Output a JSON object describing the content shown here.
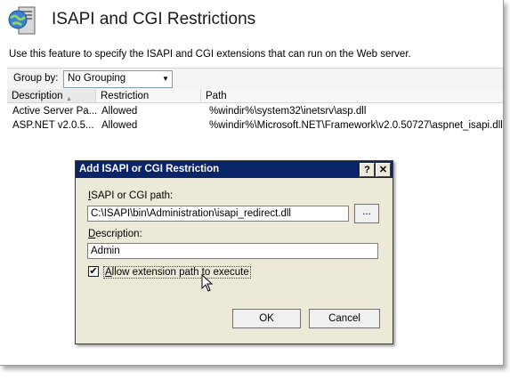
{
  "header": {
    "title": "ISAPI and CGI Restrictions",
    "description": "Use this feature to specify the ISAPI and CGI extensions that can run on the Web server."
  },
  "group_bar": {
    "label": "Group by:",
    "selected": "No Grouping"
  },
  "grid": {
    "columns": [
      "Description",
      "Restriction",
      "Path"
    ],
    "rows": [
      {
        "description": "Active Server Pa...",
        "restriction": "Allowed",
        "path": "%windir%\\system32\\inetsrv\\asp.dll"
      },
      {
        "description": "ASP.NET v2.0.5...",
        "restriction": "Allowed",
        "path": "%windir%\\Microsoft.NET\\Framework\\v2.0.50727\\aspnet_isapi.dll"
      }
    ]
  },
  "dialog": {
    "title": "Add ISAPI or CGI Restriction",
    "help_button": "?",
    "close_button": "✕",
    "path_label_mnemonic": "I",
    "path_label_rest": "SAPI or CGI path:",
    "path_value": "C:\\ISAPI\\bin\\Administration\\isapi_redirect.dll",
    "browse_button": "...",
    "description_label_mnemonic": "D",
    "description_label_rest": "escription:",
    "description_value": "Admin",
    "allow_checked": true,
    "allow_label_mnemonic": "A",
    "allow_label_rest": "llow extension path to execute",
    "ok_button": "OK",
    "cancel_button": "Cancel"
  },
  "colors": {
    "dialog_title_bg": "#0a246a",
    "dialog_bg": "#ece9d8"
  }
}
